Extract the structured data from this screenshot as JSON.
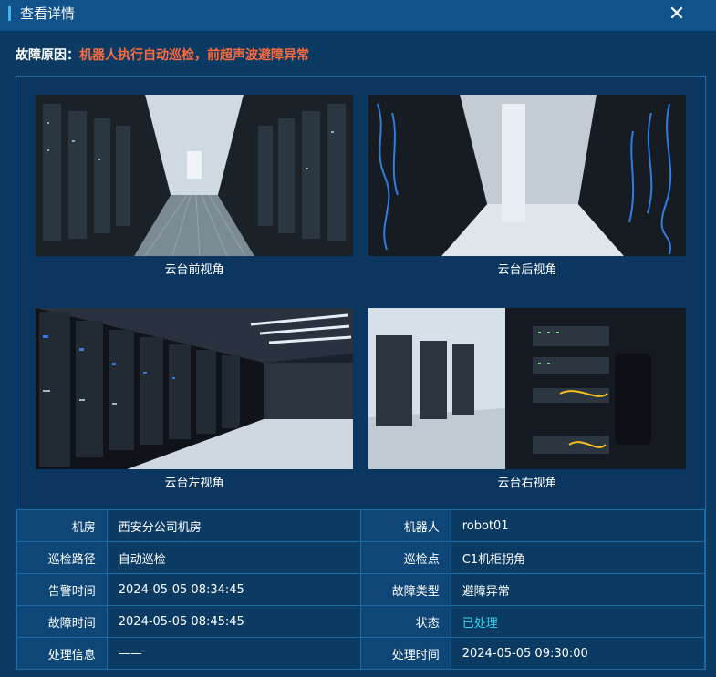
{
  "dialog": {
    "title": "查看详情",
    "close_icon": "close-icon"
  },
  "fault": {
    "label": "故障原因：",
    "value": "机器人执行自动巡检，前超声波避障异常"
  },
  "views": [
    {
      "caption": "云台前视角",
      "image": "server-room-front-view"
    },
    {
      "caption": "云台后视角",
      "image": "server-room-back-view"
    },
    {
      "caption": "云台左视角",
      "image": "server-room-left-view"
    },
    {
      "caption": "云台右视角",
      "image": "server-room-right-view"
    }
  ],
  "info": {
    "rows": [
      {
        "l1": "机房",
        "v1": "西安分公司机房",
        "l2": "机器人",
        "v2": "robot01"
      },
      {
        "l1": "巡检路径",
        "v1": "自动巡检",
        "l2": "巡检点",
        "v2": "C1机柜拐角"
      },
      {
        "l1": "告警时间",
        "v1": "2024-05-05 08:34:45",
        "l2": "故障类型",
        "v2": "避障异常"
      },
      {
        "l1": "故障时间",
        "v1": "2024-05-05 08:45:45",
        "l2": "状态",
        "v2": "已处理"
      },
      {
        "l1": "处理信息",
        "v1": "——",
        "l2": "处理时间",
        "v2": "2024-05-05 09:30:00"
      }
    ]
  },
  "colors": {
    "background": "#0b3a63",
    "titlebar": "#11528a",
    "fault_text": "#ff6a3d",
    "status_done": "#2ad6f0",
    "border": "#1d6aa8"
  }
}
